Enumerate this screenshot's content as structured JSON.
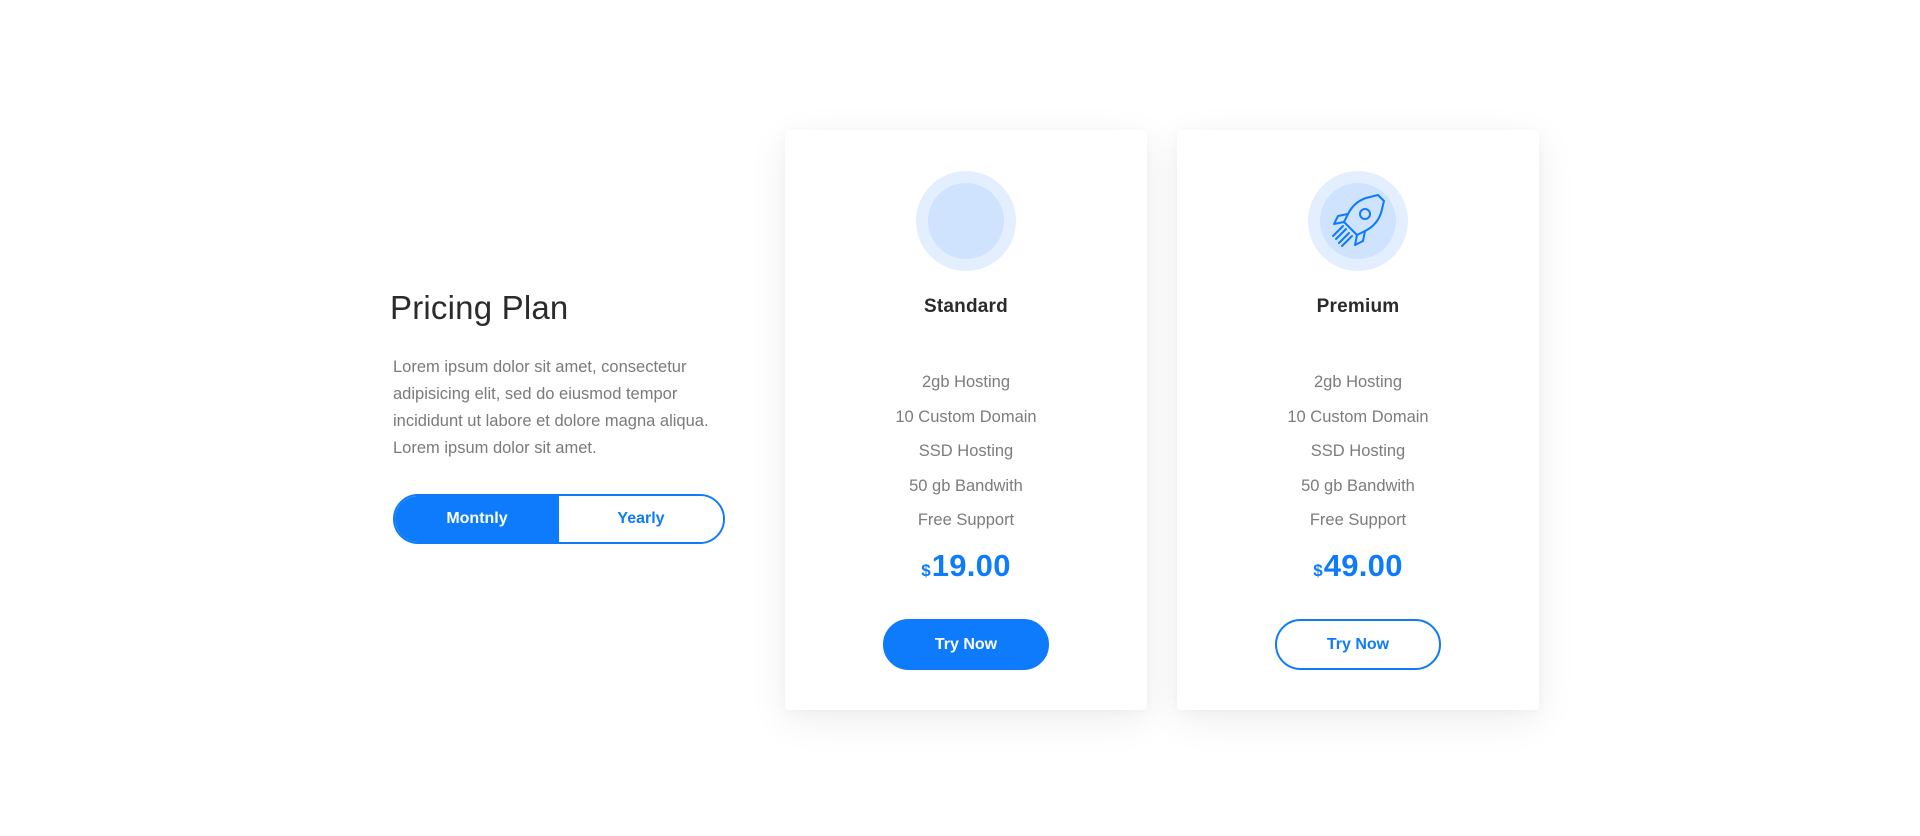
{
  "intro": {
    "title": "Pricing Plan",
    "description": "Lorem ipsum dolor sit amet, consectetur adipisicing elit, sed do eiusmod tempor incididunt ut labore et dolore magna aliqua. Lorem ipsum dolor sit amet."
  },
  "toggle": {
    "monthly_label": "Montnly",
    "yearly_label": "Yearly",
    "selected": "monthly"
  },
  "colors": {
    "accent": "#0d7bfb",
    "icon_bg": "#e3efff",
    "text_dark": "#2a2a2a",
    "text_muted": "#7c7c7c"
  },
  "plans": [
    {
      "name": "Standard",
      "icon": "empty-circle",
      "features": [
        "2gb Hosting",
        "10 Custom Domain",
        "SSD Hosting",
        "50 gb Bandwith",
        "Free Support"
      ],
      "currency": "$",
      "price": "19.00",
      "button_label": "Try Now",
      "button_style": "filled"
    },
    {
      "name": "Premium",
      "icon": "rocket-icon",
      "features": [
        "2gb Hosting",
        "10 Custom Domain",
        "SSD Hosting",
        "50 gb Bandwith",
        "Free Support"
      ],
      "currency": "$",
      "price": "49.00",
      "button_label": "Try Now",
      "button_style": "outline"
    }
  ]
}
